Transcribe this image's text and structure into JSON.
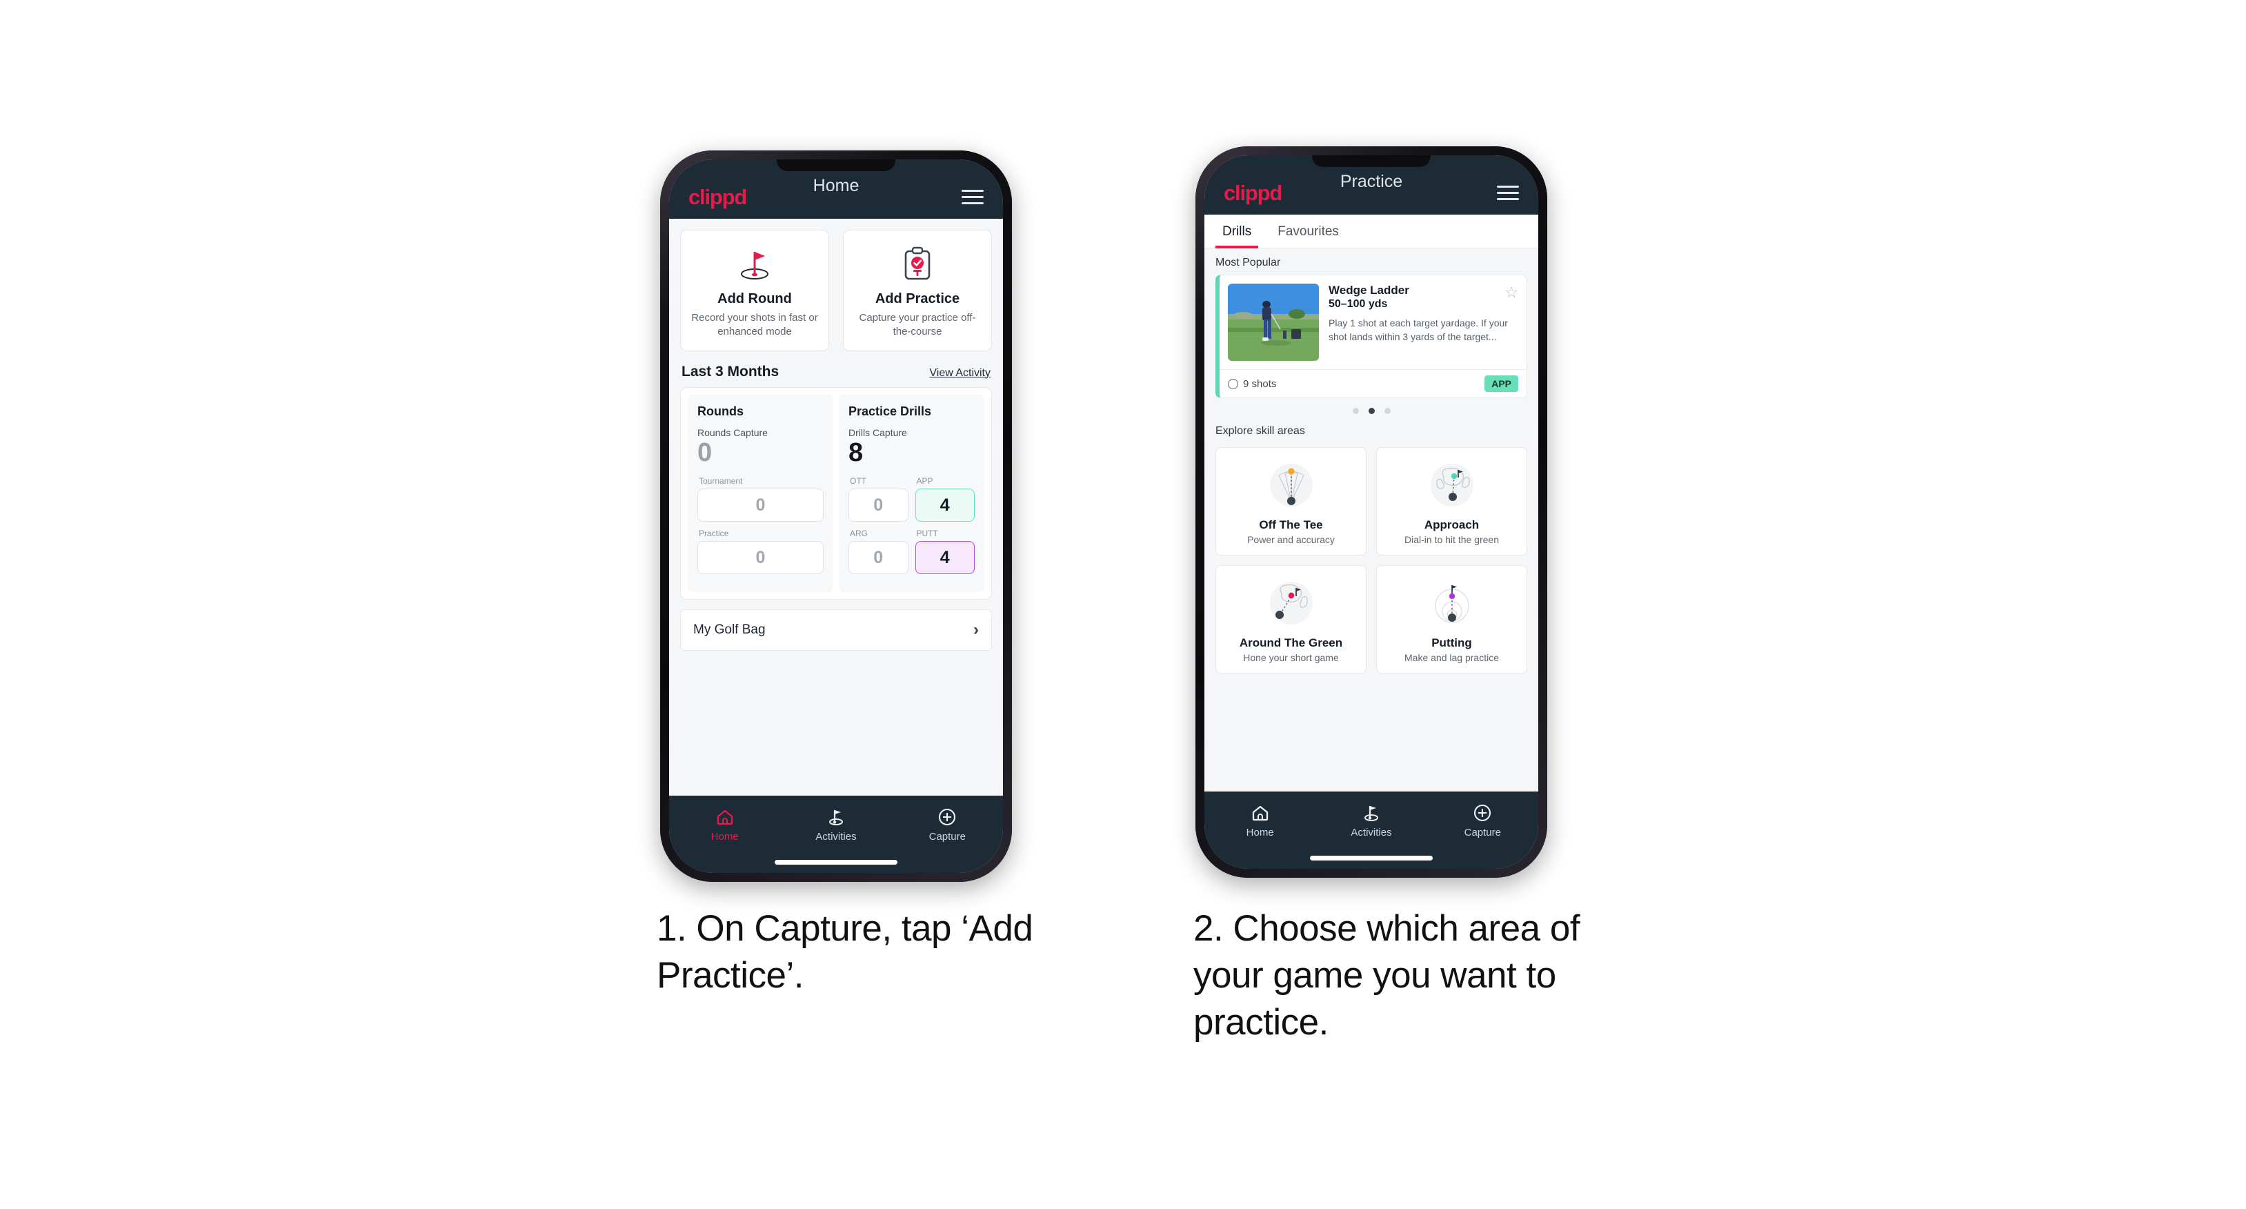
{
  "phone1": {
    "appbar": {
      "logo": "clippd",
      "title": "Home",
      "menu_icon": "hamburger-icon"
    },
    "action_cards": [
      {
        "icon": "golf-flag-hole-icon",
        "title": "Add Round",
        "subtitle": "Record your shots in fast or enhanced mode"
      },
      {
        "icon": "clipboard-check-tee-icon",
        "title": "Add Practice",
        "subtitle": "Capture your practice off-the-course"
      }
    ],
    "section": {
      "title": "Last 3 Months",
      "link": "View Activity"
    },
    "stats": {
      "rounds": {
        "heading": "Rounds",
        "capture_label": "Rounds Capture",
        "capture_value": "0",
        "fields": [
          {
            "label": "Tournament",
            "value": "0",
            "highlight": "none"
          },
          {
            "label": "Practice",
            "value": "0",
            "highlight": "none"
          }
        ]
      },
      "drills": {
        "heading": "Practice Drills",
        "capture_label": "Drills Capture",
        "capture_value": "8",
        "fields": [
          {
            "label": "OTT",
            "value": "0",
            "highlight": "none"
          },
          {
            "label": "APP",
            "value": "4",
            "highlight": "green"
          },
          {
            "label": "ARG",
            "value": "0",
            "highlight": "none"
          },
          {
            "label": "PUTT",
            "value": "4",
            "highlight": "purple"
          }
        ]
      }
    },
    "golf_bag": {
      "label": "My Golf Bag",
      "chevron": "chevron-right-icon"
    },
    "bottom_nav": [
      {
        "icon": "home-icon",
        "label": "Home",
        "active": true
      },
      {
        "icon": "golf-flag-icon",
        "label": "Activities",
        "active": false
      },
      {
        "icon": "plus-circle-icon",
        "label": "Capture",
        "active": false
      }
    ]
  },
  "phone2": {
    "appbar": {
      "logo": "clippd",
      "title": "Practice",
      "menu_icon": "hamburger-icon"
    },
    "tabs": [
      {
        "label": "Drills",
        "active": true
      },
      {
        "label": "Favourites",
        "active": false
      }
    ],
    "most_popular_label": "Most Popular",
    "drill_card": {
      "title": "Wedge Ladder",
      "yardage": "50–100 yds",
      "description": "Play 1 shot at each target yardage. If your shot lands within 3 yards of the target...",
      "shots": "9 shots",
      "tag": "APP",
      "star_icon": "star-outline-icon",
      "accent_color": "#5fd7b4",
      "next_card_accent": "#a93ad6",
      "thumbnail": "golfer-wedge-shot-photo"
    },
    "carousel_dots": {
      "count": 3,
      "active_index": 1
    },
    "explore_label": "Explore skill areas",
    "skill_areas": [
      {
        "icon": "off-the-tee-fan-icon",
        "title": "Off The Tee",
        "subtitle": "Power and accuracy",
        "dot_color": "#f5a623"
      },
      {
        "icon": "approach-green-icon",
        "title": "Approach",
        "subtitle": "Dial-in to hit the green",
        "dot_color": "#4fd9bb"
      },
      {
        "icon": "around-the-green-icon",
        "title": "Around The Green",
        "subtitle": "Hone your short game",
        "dot_color": "#e8194b"
      },
      {
        "icon": "putting-rings-icon",
        "title": "Putting",
        "subtitle": "Make and lag practice",
        "dot_color": "#a93ad6"
      }
    ],
    "bottom_nav": [
      {
        "icon": "home-icon",
        "label": "Home",
        "active": false
      },
      {
        "icon": "golf-flag-icon",
        "label": "Activities",
        "active": false
      },
      {
        "icon": "plus-circle-icon",
        "label": "Capture",
        "active": false
      }
    ]
  },
  "captions": {
    "one": "1. On Capture, tap ‘Add Practice’.",
    "two": "2. Choose which area of your game you want to practice."
  },
  "colors": {
    "brand_pink": "#e8194b",
    "navy": "#1d2b36",
    "green_accent": "#5fd7b4",
    "purple_accent": "#a93ad6",
    "page_bg": "#ffffff"
  }
}
